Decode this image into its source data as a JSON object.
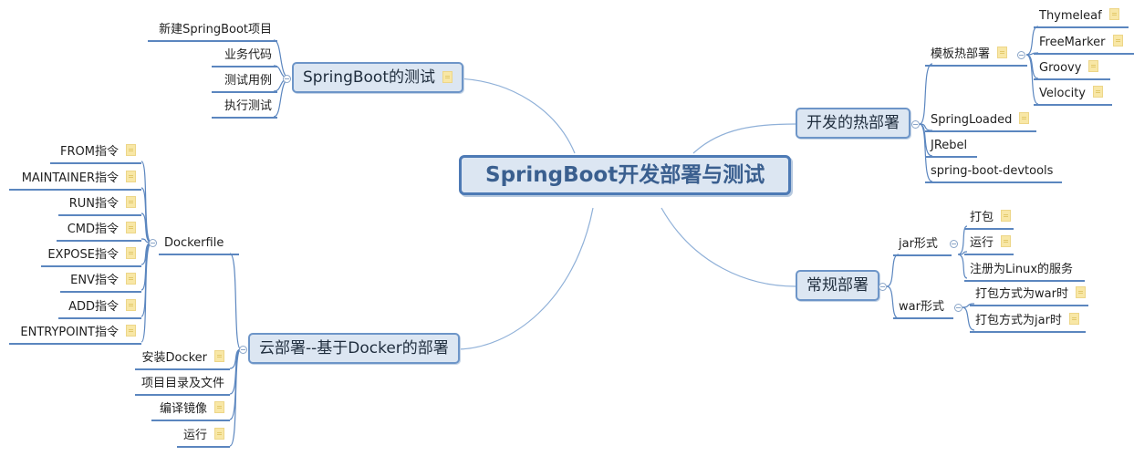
{
  "central": "SpringBoot开发部署与测试",
  "testing": {
    "title": "SpringBoot的测试",
    "children": [
      "新建SpringBoot项目",
      "业务代码",
      "测试用例",
      "执行测试"
    ]
  },
  "hot_deploy": {
    "title": "开发的热部署",
    "template": {
      "title": "模板热部署",
      "children": [
        "Thymeleaf",
        "FreeMarker",
        "Groovy",
        "Velocity"
      ]
    },
    "children": [
      "SpringLoaded",
      "JRebel",
      "spring-boot-devtools"
    ]
  },
  "regular_deploy": {
    "title": "常规部署",
    "jar": {
      "title": "jar形式",
      "children": [
        "打包",
        "运行",
        "注册为Linux的服务"
      ]
    },
    "war": {
      "title": "war形式",
      "children": [
        "打包方式为war时",
        "打包方式为jar时"
      ]
    }
  },
  "cloud_deploy": {
    "title": "云部署--基于Docker的部署",
    "dockerfile": {
      "title": "Dockerfile",
      "children": [
        "FROM指令",
        "MAINTAINER指令",
        "RUN指令",
        "CMD指令",
        "EXPOSE指令",
        "ENV指令",
        "ADD指令",
        "ENTRYPOINT指令"
      ]
    },
    "children": [
      "安装Docker",
      "项目目录及文件",
      "编译镜像",
      "运行"
    ]
  },
  "colors": {
    "line": "#5b86bf",
    "topic_fill": "#dce6f2",
    "central_text": "#3a5f8f",
    "note": "#f8e7a6"
  }
}
